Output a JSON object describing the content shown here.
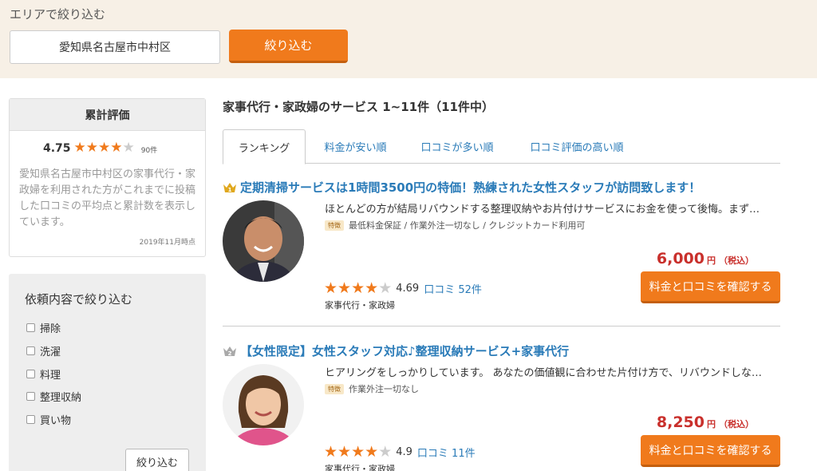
{
  "area": {
    "title": "エリアで絞り込む",
    "input_value": "愛知県名古屋市中村区",
    "button_label": "絞り込む"
  },
  "rating_summary": {
    "title": "累計評価",
    "score": "4.75",
    "stars_filled": 4,
    "stars_total": 5,
    "count": "90件",
    "description": "愛知県名古屋市中村区の家事代行・家政婦を利用された方がこれまでに投稿した口コミの平均点と累計数を表示しています。",
    "as_of": "2019年11月時点"
  },
  "category_filter": {
    "title": "依頼内容で絞り込む",
    "items": [
      "掃除",
      "洗濯",
      "料理",
      "整理収納",
      "買い物"
    ],
    "button_label": "絞り込む"
  },
  "main": {
    "title": "家事代行・家政婦のサービス 1~11件（11件中）",
    "tabs": [
      "ランキング",
      "料金が安い順",
      "口コミが多い順",
      "口コミ評価の高い順"
    ],
    "active_tab": 0
  },
  "listings": [
    {
      "rank": 1,
      "title": "定期清掃サービスは1時間3500円の特価！熟練された女性スタッフが訪問致します！",
      "description": "ほとんどの方が結局リバウンドする整理収納やお片付けサービスにお金を使って後悔。まず…",
      "feature_badge": "特徴",
      "features": "最低料金保証 / 作業外注一切なし / クレジットカード利用可",
      "price": "6,000",
      "price_unit": "円",
      "price_tax": "（税込）",
      "stars_filled": 4,
      "score": "4.69",
      "reviews": "口コミ 52件",
      "category": "家事代行・家政婦",
      "cta": "料金と口コミを確認する"
    },
    {
      "rank": 2,
      "title": "【女性限定】女性スタッフ対応♪整理収納サービス+家事代行",
      "description": "ヒアリングをしっかりしています。 あなたの価値観に合わせた片付け方で、リバウンドしな…",
      "feature_badge": "特徴",
      "features": "作業外注一切なし",
      "price": "8,250",
      "price_unit": "円",
      "price_tax": "（税込）",
      "stars_filled": 4,
      "score": "4.9",
      "reviews": "口コミ 11件",
      "category": "家事代行・家政婦",
      "cta": "料金と口コミを確認する"
    }
  ],
  "colors": {
    "accent": "#f07a1c",
    "link": "#2a7bb8",
    "price": "#c9302c",
    "area_bg": "#f7f0e6"
  }
}
